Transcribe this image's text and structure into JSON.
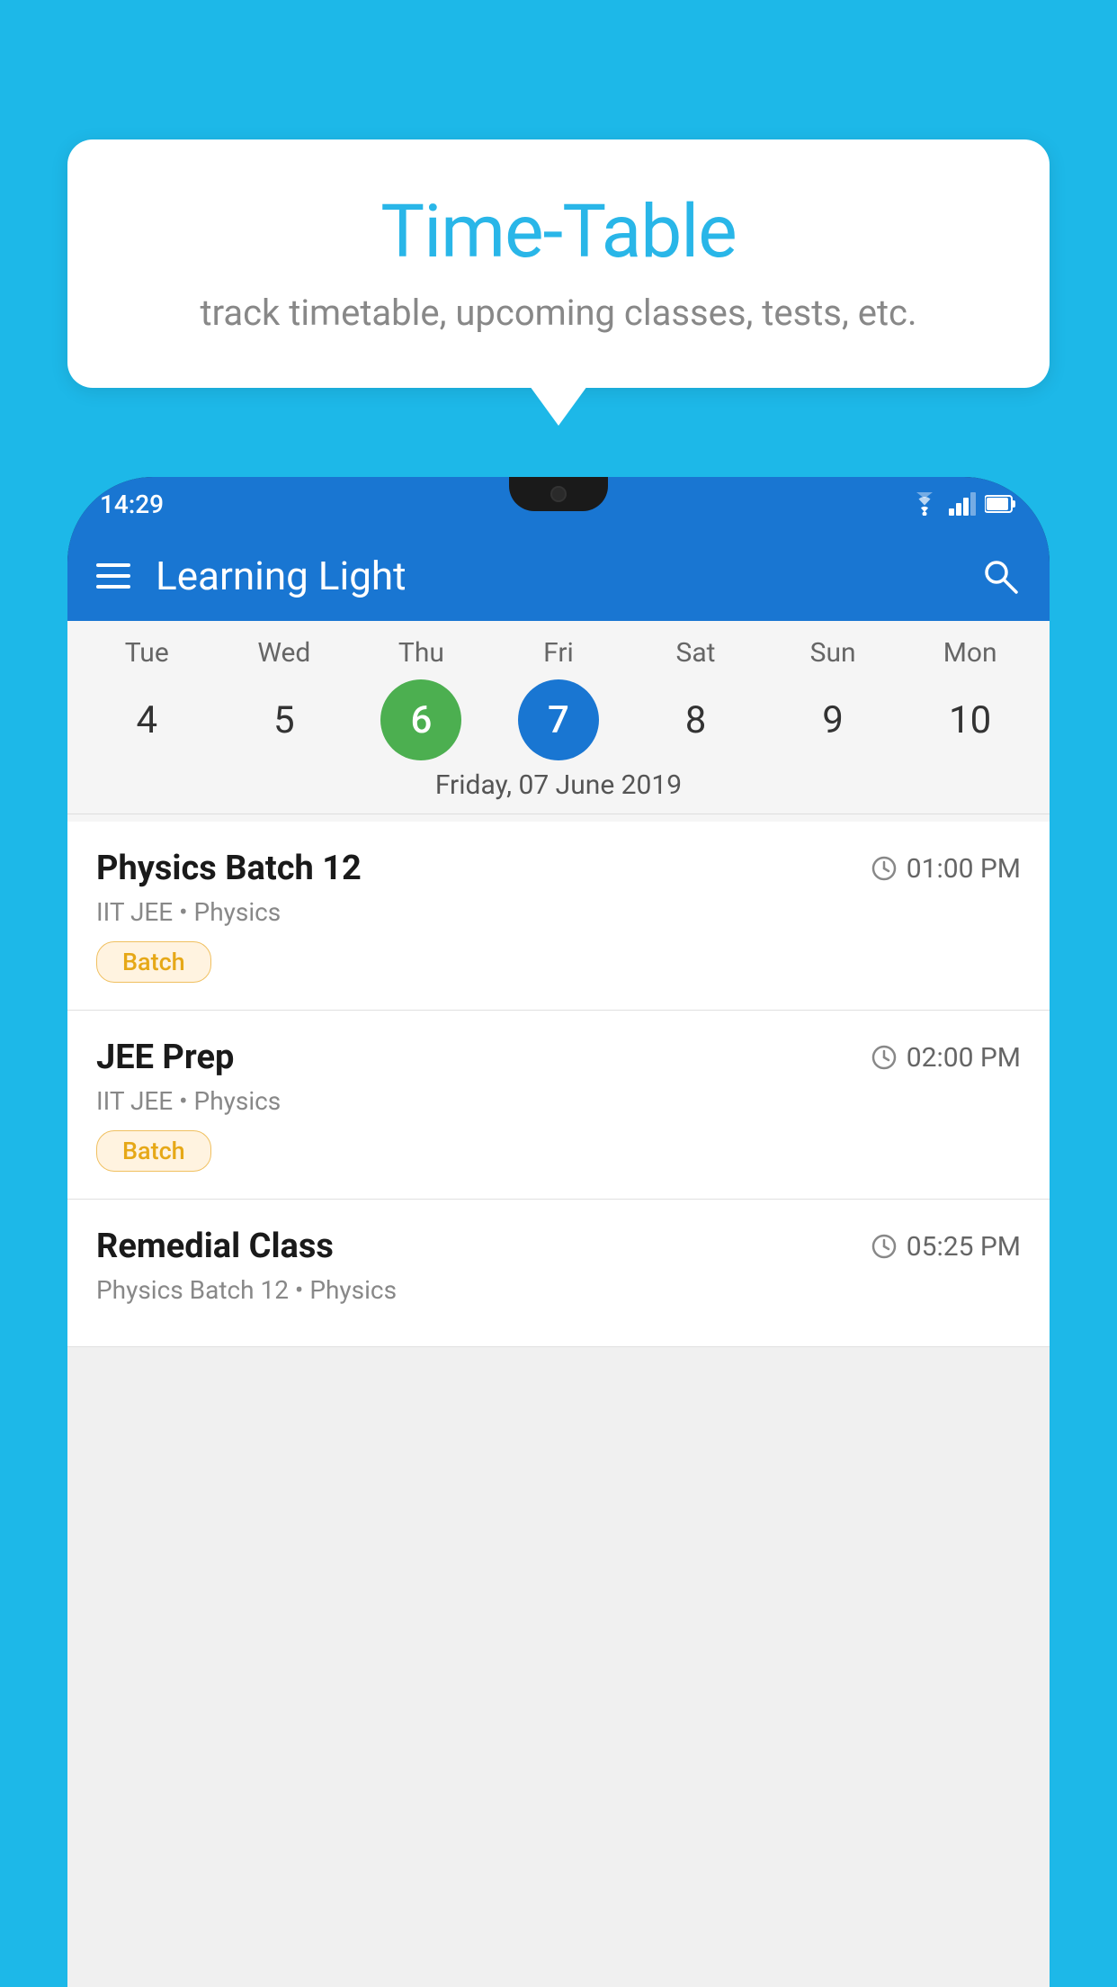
{
  "background_color": "#1db8e8",
  "tooltip": {
    "title": "Time-Table",
    "subtitle": "track timetable, upcoming classes, tests, etc."
  },
  "app": {
    "name": "Learning Light",
    "status_time": "14:29"
  },
  "calendar": {
    "days": [
      {
        "label": "Tue",
        "number": "4"
      },
      {
        "label": "Wed",
        "number": "5"
      },
      {
        "label": "Thu",
        "number": "6",
        "state": "today"
      },
      {
        "label": "Fri",
        "number": "7",
        "state": "selected"
      },
      {
        "label": "Sat",
        "number": "8"
      },
      {
        "label": "Sun",
        "number": "9"
      },
      {
        "label": "Mon",
        "number": "10"
      }
    ],
    "selected_date": "Friday, 07 June 2019"
  },
  "schedule": {
    "items": [
      {
        "title": "Physics Batch 12",
        "time": "01:00 PM",
        "subtitle": "IIT JEE • Physics",
        "badge": "Batch"
      },
      {
        "title": "JEE Prep",
        "time": "02:00 PM",
        "subtitle": "IIT JEE • Physics",
        "badge": "Batch"
      },
      {
        "title": "Remedial Class",
        "time": "05:25 PM",
        "subtitle": "Physics Batch 12 • Physics",
        "badge": null
      }
    ]
  },
  "labels": {
    "hamburger": "menu",
    "search": "search",
    "batch_badge": "Batch"
  }
}
